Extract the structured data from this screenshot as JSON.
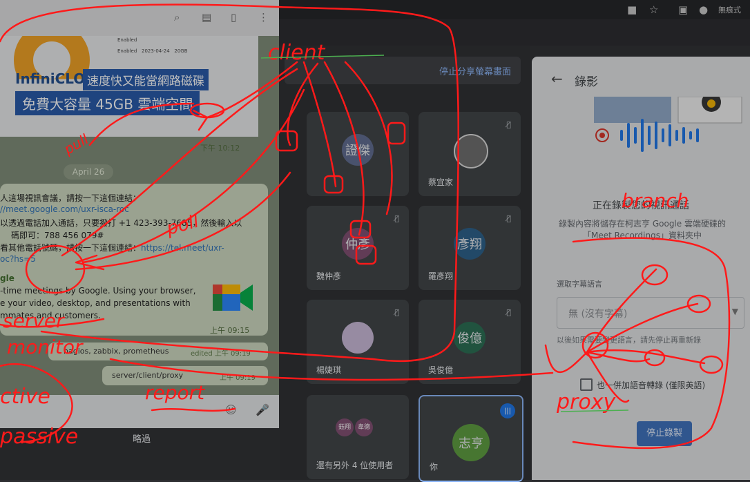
{
  "browser": {
    "profile_label": "無痕式"
  },
  "meet": {
    "stop_sharing": "停止分享螢幕畫面",
    "participants": [
      {
        "name": "",
        "avatar_text": "證傑",
        "avatar_color": "#5e6a8f"
      },
      {
        "name": "蔡宜家",
        "avatar_text": "",
        "avatar_color": "#6b6b6b"
      },
      {
        "name": "魏仲彥",
        "avatar_text": "仲彥",
        "avatar_color": "#7e4b6f"
      },
      {
        "name": "羅彥翔",
        "avatar_text": "彥翔",
        "avatar_color": "#285d88"
      },
      {
        "name": "楊婕琪",
        "avatar_text": "",
        "avatar_color": "#c9b9d9"
      },
      {
        "name": "吳俊億",
        "avatar_text": "俊億",
        "avatar_color": "#266b4f"
      }
    ],
    "others_label": "還有另外 4 位使用者",
    "others_avatars": [
      "鈺翔",
      "韋德"
    ],
    "self": {
      "name": "你",
      "avatar_text": "志亨"
    },
    "bottom_label": "略過"
  },
  "telegram": {
    "ad": {
      "brand": "InfiniCLO",
      "headline": "速度快又能當網路磁碟",
      "sub": "免費大容量 45GB 雲端空間",
      "row1": "Enabled",
      "row2": "Enabled",
      "row2_date": "2023-04-24",
      "row2_size": "20GB",
      "time": "下午 10:12"
    },
    "date": "April 26",
    "message": {
      "line1": "人這場視訊會議，請按一下這個連結：",
      "line2": "//meet.google.com/uxr-isca-roc",
      "line3": "以透過電話加入通話，只要撥打 +1 423-393-7685，然後輸入以",
      "line4": "碼即可：788 456 079#",
      "line5a": "看其他電話號碼，請按一下這個連結：",
      "line5b": "https://tel.meet/uxr-",
      "line6": "oc?hs=5",
      "line7": "gle",
      "line8": "-time meetings by Google. Using your browser,",
      "line9": "e your video, desktop, and presentations with",
      "line10": "mmates and customers.",
      "time": "上午 09:15"
    },
    "reply1": {
      "text": "nagios, zabbix, prometheus",
      "edited": "edited 上午 09:19"
    },
    "reply2": {
      "text": "server/client/proxy",
      "time": "上午 09:19"
    }
  },
  "recording": {
    "title": "錄影",
    "status": "正在錄製您的視訊通話",
    "desc": "錄製內容將儲存在柯志亨 Google 雲端硬碟的「Meet Recordings」資料夾中",
    "caption_label": "選取字幕語言",
    "caption_value": "無 (沒有字幕)",
    "caption_hint": "以後如果需要變更語言，請先停止再重新錄",
    "translate_label": "也一併加語音轉錄 (僅限英語)",
    "stop_button": "停止錄製"
  },
  "annotations": {
    "client": "client",
    "server": "server",
    "monitor": "monitor",
    "active": "ctive",
    "passive": "passive",
    "report": "report",
    "proxy": "proxy",
    "branch": "branch",
    "pull": "pull",
    "poll": "poll",
    "color": "#ff1a1a"
  }
}
